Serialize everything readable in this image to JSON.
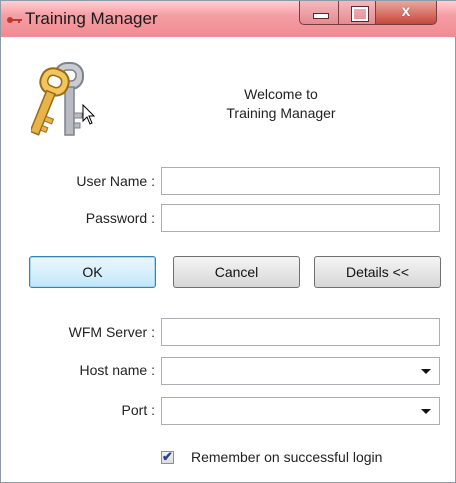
{
  "window": {
    "title": "Training Manager",
    "close_glyph": "x"
  },
  "header": {
    "welcome_line1": "Welcome to",
    "welcome_line2": "Training Manager",
    "logo_icon": "keys-icon"
  },
  "login": {
    "username_label": "User Name :",
    "username_value": "",
    "password_label": "Password :",
    "password_value": ""
  },
  "buttons": {
    "ok": "OK",
    "cancel": "Cancel",
    "details": "Details <<"
  },
  "details": {
    "server_label": "WFM Server :",
    "server_value": "",
    "host_label": "Host name :",
    "host_value": "",
    "port_label": "Port :",
    "port_value": ""
  },
  "remember": {
    "label": "Remember on successful login",
    "checked": true
  },
  "colors": {
    "titlebar": "#ef8b92",
    "ok_border": "#3c7fb1",
    "key_gold": "#e6b44a",
    "key_silver": "#b8bcc2"
  }
}
